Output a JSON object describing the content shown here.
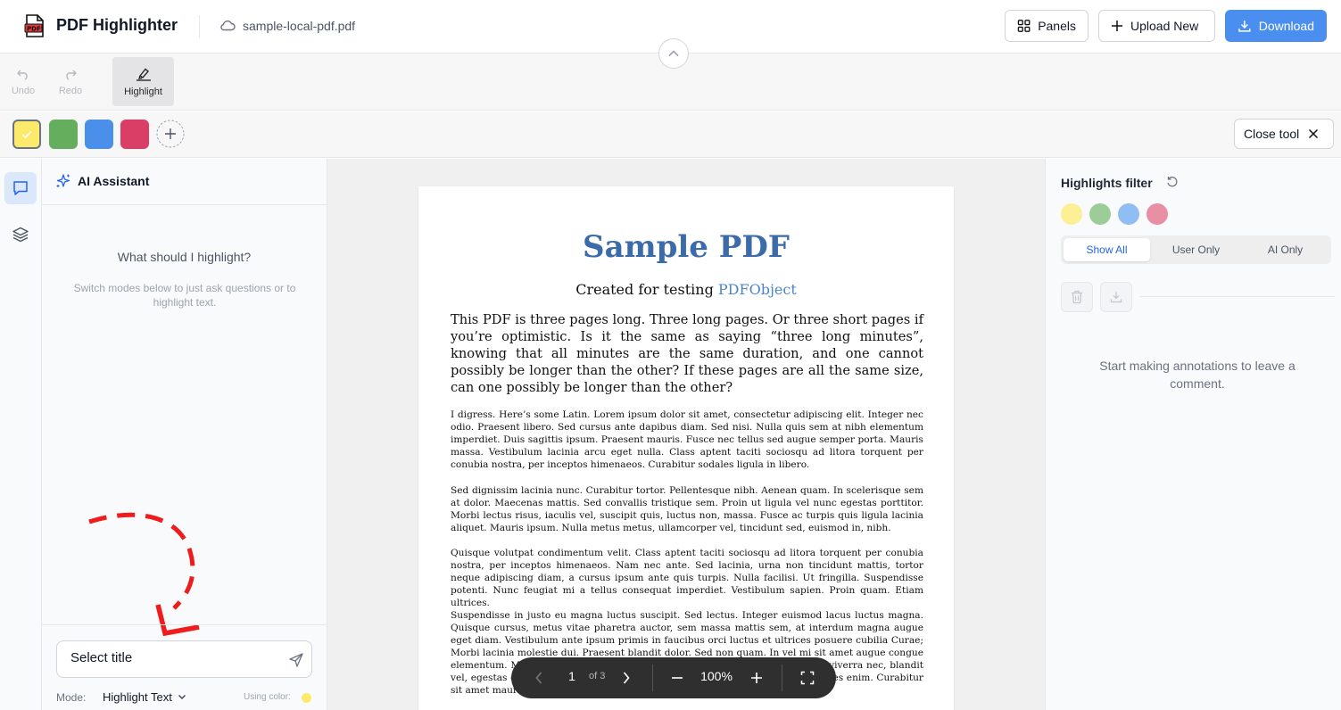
{
  "header": {
    "app_title": "PDF Highlighter",
    "file_name": "sample-local-pdf.pdf",
    "panels_label": "Panels",
    "upload_label": "Upload New",
    "download_label": "Download",
    "logo_text": "PDF"
  },
  "toolbar": {
    "undo_label": "Undo",
    "redo_label": "Redo",
    "highlight_label": "Highlight"
  },
  "colors": {
    "swatches": [
      "#fde96a",
      "#64ae5d",
      "#4a90ea",
      "#da3e67"
    ],
    "selected": "yellow",
    "close_tool_label": "Close tool"
  },
  "ai_panel": {
    "title": "AI Assistant",
    "prompt": "What should I highlight?",
    "hint": "Switch modes below to just ask questions or to highlight text.",
    "input_value": "Select title",
    "mode_label": "Mode:",
    "mode_value": "Highlight Text",
    "using_color_label": "Using color:"
  },
  "document": {
    "title": "Sample PDF",
    "subtitle_prefix": "Created for testing ",
    "subtitle_link": "PDFObject",
    "intro": "This PDF is three pages long. Three long pages. Or three short pages if you’re optimistic. Is it the same as saying “three long minutes”, knowing that all minutes are the same duration, and one cannot possibly be longer than the other? If these pages are all the same size, can one possibly be longer than the other?",
    "para1": "I digress. Here’s some Latin. Lorem ipsum dolor sit amet, consectetur adipiscing elit. Integer nec odio. Praesent libero. Sed cursus ante dapibus diam. Sed nisi. Nulla quis sem at nibh elementum imperdiet. Duis sagittis ipsum. Praesent mauris. Fusce nec tellus sed augue semper porta. Mauris massa. Vestibulum lacinia arcu eget nulla. Class aptent taciti sociosqu ad litora torquent per conubia nostra, per inceptos himenaeos. Curabitur sodales ligula in libero.",
    "para2": "Sed dignissim lacinia nunc. Curabitur tortor. Pellentesque nibh. Aenean quam. In scelerisque sem at dolor. Maecenas mattis. Sed convallis tristique sem. Proin ut ligula vel nunc egestas porttitor. Morbi lectus risus, iaculis vel, suscipit quis, luctus non, massa. Fusce ac turpis quis ligula lacinia aliquet. Mauris ipsum. Nulla metus metus, ullamcorper vel, tincidunt sed, euismod in, nibh.",
    "para3": "Quisque volutpat condimentum velit. Class aptent taciti sociosqu ad litora torquent per conubia nostra, per inceptos himenaeos. Nam nec ante. Sed lacinia, urna non tincidunt mattis, tortor neque adipiscing diam, a cursus ipsum ante quis turpis. Nulla facilisi. Ut fringilla. Suspendisse potenti. Nunc feugiat mi a tellus consequat imperdiet. Vestibulum sapien. Proin quam. Etiam ultrices.",
    "para4": "Suspendisse in justo eu magna luctus suscipit. Sed lectus. Integer euismod lacus luctus magna. Quisque cursus, metus vitae pharetra auctor, sem massa mattis sem, at interdum magna augue eget diam. Vestibulum ante ipsum primis in faucibus orci luctus et ultrices posuere cubilia Curae; Morbi lacinia molestie dui. Praesent blandit dolor. Sed non quam. In vel mi sit amet augue congue elementum. Morbi in ipsum sit amet pede facilisis laoreet. Donec lacus nunc, viverra nec, blandit vel, egestas et, augue. Vestibulum tincidunt malesuada tellus. Ut ultrices ultrices enim. Curabitur sit amet mauris."
  },
  "pager": {
    "page": "1",
    "of_label": "of 3",
    "zoom": "100%"
  },
  "right_panel": {
    "title": "Highlights filter",
    "filter_colors": [
      "#fdef95",
      "#9ccd98",
      "#90bdf3",
      "#e88ea5"
    ],
    "tabs": [
      "Show All",
      "User Only",
      "AI Only"
    ],
    "empty_text": "Start making annotations to leave a comment."
  }
}
